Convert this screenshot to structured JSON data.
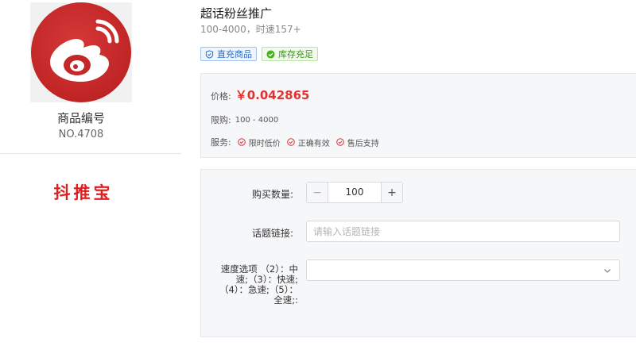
{
  "product": {
    "code_label": "商品编号",
    "code": "NO.4708",
    "brand": "抖推宝",
    "title": "超话粉丝推广",
    "subtitle": "100-4000，时速157+"
  },
  "tags": [
    {
      "label": "直充商品",
      "icon": "shield-icon",
      "color": "#2f6ec4"
    },
    {
      "label": "库存充足",
      "icon": "check-circle-icon",
      "color": "#3f8e1f"
    }
  ],
  "pricing": {
    "price_label": "价格:",
    "price": "￥0.042865",
    "limit_label": "限购:",
    "limit": "100 - 4000",
    "service_label": "服务:",
    "services": [
      "限时低价",
      "正确有效",
      "售后支持"
    ]
  },
  "form": {
    "quantity_label": "购买数量:",
    "quantity": "100",
    "minus": "−",
    "plus": "+",
    "topic_label": "话题链接:",
    "topic_placeholder": "请输入话题链接",
    "speed_label": "速度选项 （2）：中速;（3）：快速;（4）：急速;（5）：全速;:",
    "speed_selected": ""
  },
  "colors": {
    "price": "#e53030",
    "brand": "#e02020",
    "weibo_red": "#c32727"
  }
}
